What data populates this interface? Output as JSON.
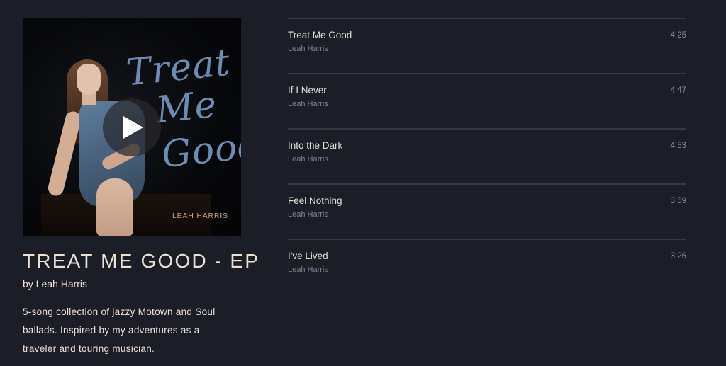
{
  "album": {
    "cover": {
      "script_line1": "Treat",
      "script_line2": "Me",
      "script_line3": "Good",
      "artist_text": "LEAH HARRIS"
    },
    "play_icon": "play-icon",
    "title": "TREAT ME GOOD - EP",
    "by_line": "by Leah Harris",
    "description": "5-song collection of jazzy Motown and Soul ballads. Inspired by my adventures as a traveler and touring musician."
  },
  "tracks": [
    {
      "title": "Treat Me Good",
      "artist": "Leah Harris",
      "duration": "4:25"
    },
    {
      "title": "If I Never",
      "artist": "Leah Harris",
      "duration": "4:47"
    },
    {
      "title": "Into the Dark",
      "artist": "Leah Harris",
      "duration": "4:53"
    },
    {
      "title": "Feel Nothing",
      "artist": "Leah Harris",
      "duration": "3:59"
    },
    {
      "title": "I've Lived",
      "artist": "Leah Harris",
      "duration": "3:26"
    }
  ],
  "colors": {
    "background": "#1b1e27",
    "text_primary": "#efdfd3",
    "text_muted": "#7d8290",
    "divider": "#343946",
    "cover_script": "#6e8bb2"
  }
}
